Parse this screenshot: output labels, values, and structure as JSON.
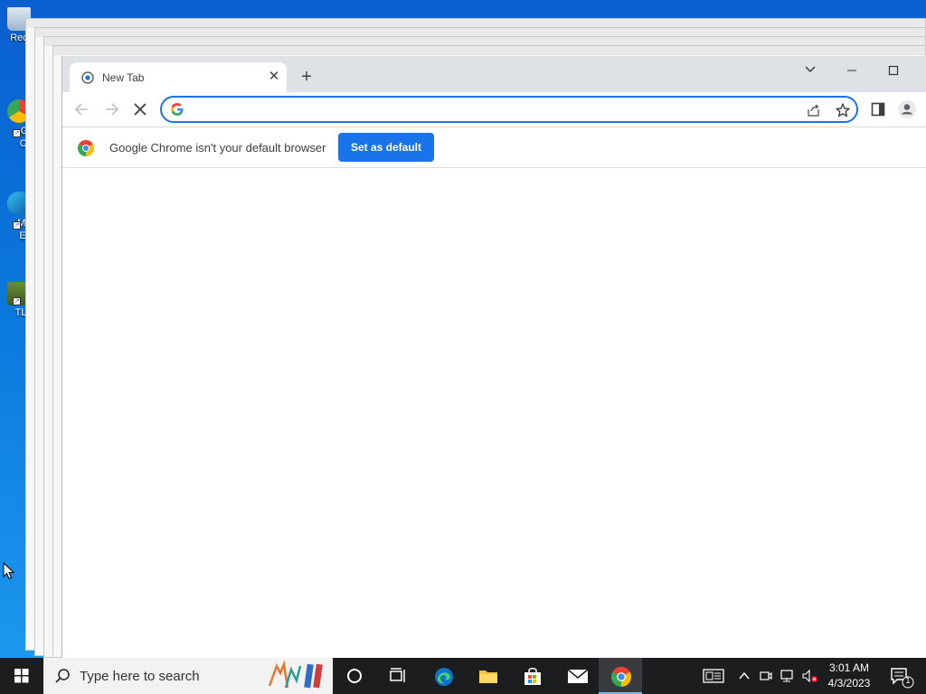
{
  "desktop": {
    "icons": [
      {
        "label": "Rec"
      },
      {
        "label": "G Cl"
      },
      {
        "label": "Mi E"
      },
      {
        "label": "TL"
      }
    ]
  },
  "browser": {
    "tab": {
      "title": "New Tab"
    },
    "address": {
      "value": "",
      "placeholder": ""
    },
    "infobar": {
      "message": "Google Chrome isn't your default browser",
      "button_label": "Set as default"
    }
  },
  "taskbar": {
    "search_placeholder": "Type here to search",
    "clock": {
      "time": "3:01 AM",
      "date": "4/3/2023"
    },
    "notification_count": "1"
  },
  "colors": {
    "accent": "#1a73e8",
    "taskbar": "#1c1d1f",
    "desktop": "#0b78dc"
  }
}
